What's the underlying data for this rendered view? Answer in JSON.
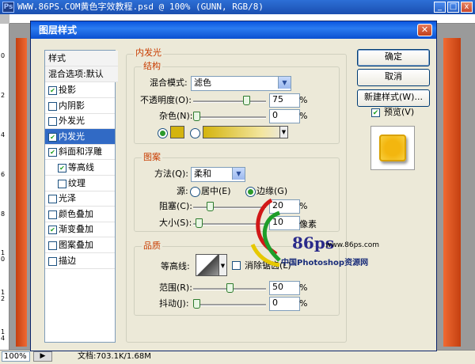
{
  "document": {
    "title": "WWW.86PS.COM黄色字效教程.psd @ 100% (GUNN, RGB/8)",
    "zoom": "100%",
    "doc_info": "文档:703.1K/1.68M",
    "ruler_left_marks": [
      "0",
      "2",
      "4",
      "6",
      "8",
      "1\n0",
      "1\n2",
      "1\n4"
    ]
  },
  "dialog": {
    "title": "图层样式",
    "close_glyph": "✕",
    "style_list": {
      "header": "样式",
      "blend_default": "混合选项:默认",
      "items": [
        {
          "label": "投影",
          "checked": true,
          "selected": false,
          "indent": false
        },
        {
          "label": "内阴影",
          "checked": false,
          "selected": false,
          "indent": false
        },
        {
          "label": "外发光",
          "checked": false,
          "selected": false,
          "indent": false
        },
        {
          "label": "内发光",
          "checked": true,
          "selected": true,
          "indent": false
        },
        {
          "label": "斜面和浮雕",
          "checked": true,
          "selected": false,
          "indent": false
        },
        {
          "label": "等高线",
          "checked": true,
          "selected": false,
          "indent": true
        },
        {
          "label": "纹理",
          "checked": false,
          "selected": false,
          "indent": true
        },
        {
          "label": "光泽",
          "checked": false,
          "selected": false,
          "indent": false
        },
        {
          "label": "颜色叠加",
          "checked": false,
          "selected": false,
          "indent": false
        },
        {
          "label": "渐变叠加",
          "checked": true,
          "selected": false,
          "indent": false
        },
        {
          "label": "图案叠加",
          "checked": false,
          "selected": false,
          "indent": false
        },
        {
          "label": "描边",
          "checked": false,
          "selected": false,
          "indent": false
        }
      ]
    },
    "panel_title": "内发光",
    "structure": {
      "title": "结构",
      "blend_mode_label": "混合模式:",
      "blend_mode_value": "滤色",
      "opacity_label": "不透明度(O):",
      "opacity_value": "75",
      "opacity_level": 0.75,
      "noise_label": "杂色(N):",
      "noise_value": "0",
      "noise_level": 0.0,
      "glow_color": "#d4b40e",
      "percent": "%"
    },
    "elements": {
      "title": "图案",
      "method_label": "方法(Q):",
      "method_value": "柔和",
      "source_label": "源:",
      "source_center": "居中(E)",
      "source_edge": "边缘(G)",
      "choke_label": "阻塞(C):",
      "choke_value": "20",
      "choke_level": 0.2,
      "size_label": "大小(S):",
      "size_value": "10",
      "size_level": 0.04,
      "size_unit": "像素",
      "percent": "%"
    },
    "quality": {
      "title": "品质",
      "contour_label": "等高线:",
      "antialias_label": "消除锯齿(L)",
      "range_label": "范围(R):",
      "range_value": "50",
      "range_level": 0.5,
      "jitter_label": "抖动(J):",
      "jitter_value": "0",
      "jitter_level": 0.0,
      "percent": "%"
    },
    "buttons": {
      "ok": "确定",
      "cancel": "取消",
      "new_style": "新建样式(W)...",
      "preview": "预览(V)"
    },
    "preview_swatch_color": "#f3b60f"
  },
  "watermark": {
    "logo": "86ps",
    "url": "www.86ps.com",
    "caption": "中国Photoshop资源网"
  }
}
